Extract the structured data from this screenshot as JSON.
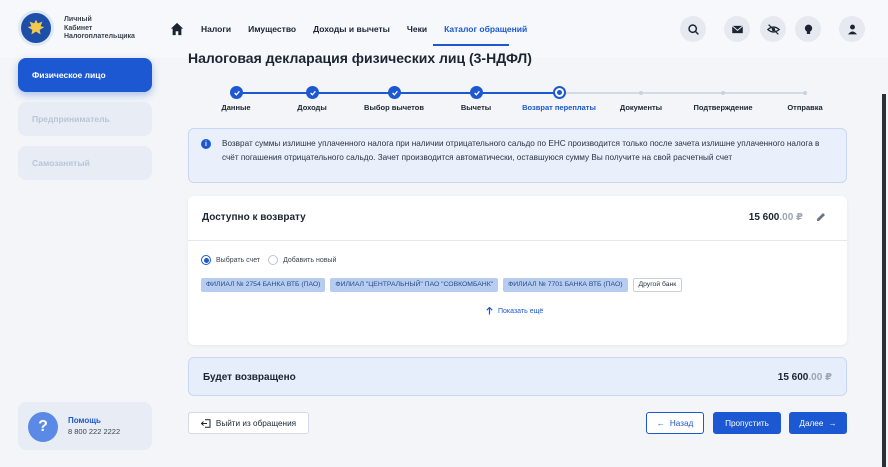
{
  "header": {
    "brand_line1": "Личный",
    "brand_line2": "Кабинет",
    "brand_line3": "Налогоплательщика",
    "nav": [
      "Налоги",
      "Имущество",
      "Доходы и вычеты",
      "Чеки",
      "Каталог обращений"
    ],
    "active_nav": "Каталог обращений",
    "icons": [
      "search-icon",
      "mail-icon",
      "eye-off-icon",
      "lightbulb-icon",
      "user-icon"
    ]
  },
  "sidebar": {
    "items": [
      "Физическое лицо",
      "Предприниматель",
      "Самозанятый"
    ],
    "help_title": "Помощь",
    "help_phone": "8 800 222 2222"
  },
  "main": {
    "title": "Налоговая декларация физических лиц (3-НДФЛ)",
    "steps": [
      {
        "label": "Данные",
        "state": "done"
      },
      {
        "label": "Доходы",
        "state": "done"
      },
      {
        "label": "Выбор вычетов",
        "state": "done"
      },
      {
        "label": "Вычеты",
        "state": "done"
      },
      {
        "label": "Возврат переплаты",
        "state": "current"
      },
      {
        "label": "Документы",
        "state": "future"
      },
      {
        "label": "Подтверждение",
        "state": "future"
      },
      {
        "label": "Отправка",
        "state": "future"
      }
    ],
    "info_text": "Возврат суммы излишне уплаченного налога при наличии отрицательного сальдо по ЕНС производится только после зачета излишне уплаченного налога в счёт погашения отрицательного сальдо. Зачет производится автоматически, оставшуюся сумму Вы получите на свой расчетный счет",
    "available": {
      "title": "Доступно к возврату",
      "amount_main": "15 600",
      "amount_cents": ".00 ₽"
    },
    "radio_select": "Выбрать счет",
    "radio_add": "Добавить новый",
    "banks": [
      "ФИЛИАЛ № 2754 БАНКА ВТБ (ПАО)",
      "ФИЛИАЛ \"ЦЕНТРАЛЬНЫЙ\" ПАО \"СОВКОМБАНК\"",
      "ФИЛИАЛ № 7701 БАНКА ВТБ (ПАО)"
    ],
    "other_bank": "Другой банк",
    "show_more": "Показать ещё",
    "result": {
      "title": "Будет возвращено",
      "amount_main": "15 600",
      "amount_cents": ".00 ₽"
    }
  },
  "footer": {
    "exit_label": "Выйти из обращения",
    "back_label": "Назад",
    "skip_label": "Пропустить",
    "next_label": "Далее"
  },
  "colors": {
    "accent": "#1c58d1",
    "background": "#f3f5f8"
  }
}
